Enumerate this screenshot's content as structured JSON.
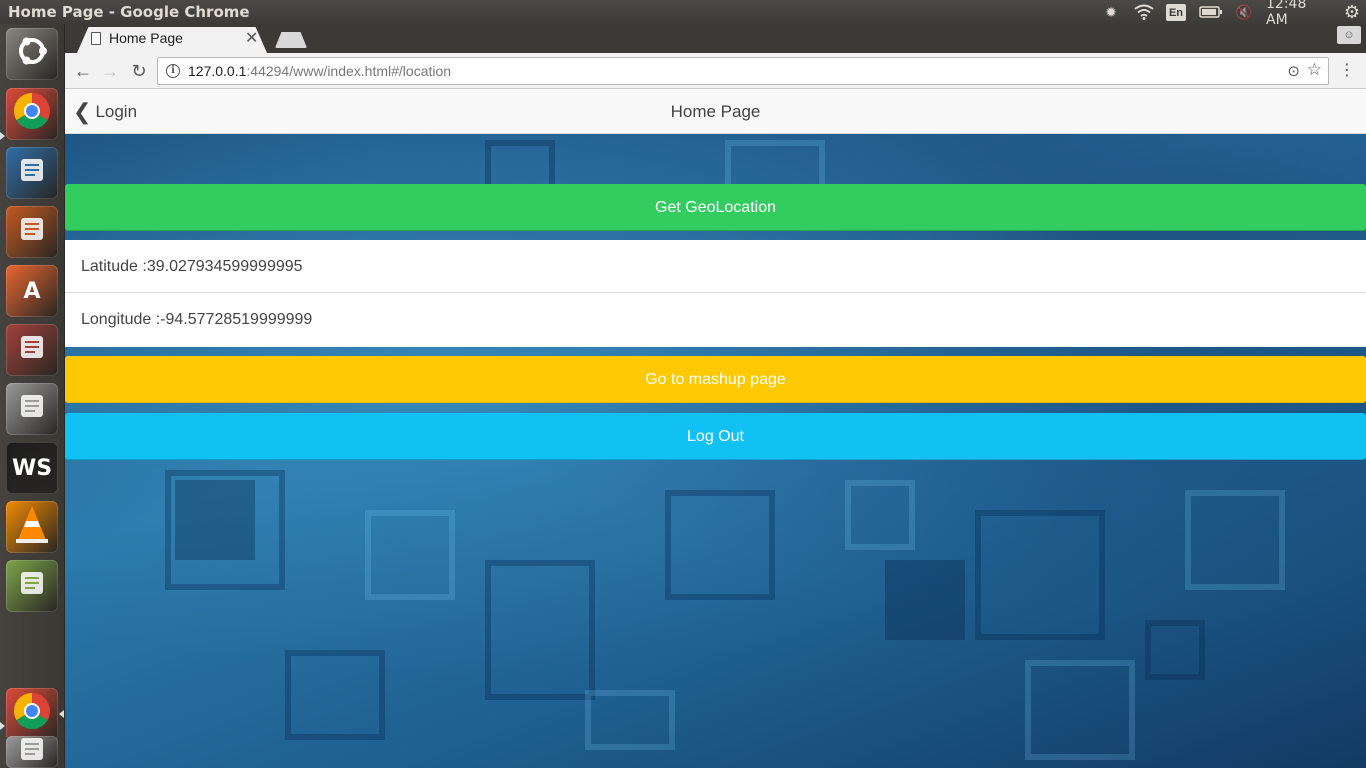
{
  "system_panel": {
    "window_title": "Home Page - Google Chrome",
    "language": "En",
    "clock": "12:48 AM"
  },
  "launcher": {
    "apps": [
      {
        "name": "Ubuntu Dash",
        "icon": "ubuntu-logo-icon",
        "color": "#8a8580"
      },
      {
        "name": "Google Chrome",
        "icon": "chrome-icon",
        "color": "#dd4b39"
      },
      {
        "name": "LibreOffice Writer",
        "icon": "writer-icon",
        "color": "#2f6ea8"
      },
      {
        "name": "LibreOffice Impress",
        "icon": "impress-icon",
        "color": "#c45a1f"
      },
      {
        "name": "Ubuntu Software",
        "icon": "software-center-icon",
        "color": "#e9662f",
        "glyph": "A"
      },
      {
        "name": "Files",
        "icon": "file-cabinet-icon",
        "color": "#a2413a"
      },
      {
        "name": "System Settings",
        "icon": "settings-wrench-icon",
        "color": "#9a9a9a"
      },
      {
        "name": "WebStorm",
        "icon": "webstorm-icon",
        "color": "#1d1d1d",
        "glyph": "WS"
      },
      {
        "name": "VLC",
        "icon": "vlc-cone-icon",
        "color": "#f08a00"
      },
      {
        "name": "Stacked apps",
        "icon": "stacked-apps-icon",
        "color": "#7da54a"
      },
      {
        "name": "Google Chrome",
        "icon": "chrome-icon",
        "color": "#dd4b39"
      },
      {
        "name": "Trash",
        "icon": "trash-icon",
        "color": "#9c9c9c"
      }
    ]
  },
  "browser": {
    "tab_title": "Home Page",
    "url_host": "127.0.0.1",
    "url_rest": ":44294/www/index.html#/location"
  },
  "app": {
    "back_label": "Login",
    "title": "Home Page",
    "geo_button": "Get GeoLocation",
    "latitude": "Latitude :39.027934599999995",
    "longitude": "Longitude :-94.57728519999999",
    "mashup_button": "Go to mashup page",
    "logout_button": "Log Out"
  },
  "colors": {
    "balanced": "#33cd5f",
    "energized": "#ffc900",
    "calm": "#11c1f3",
    "background": "#1f5f8f"
  }
}
